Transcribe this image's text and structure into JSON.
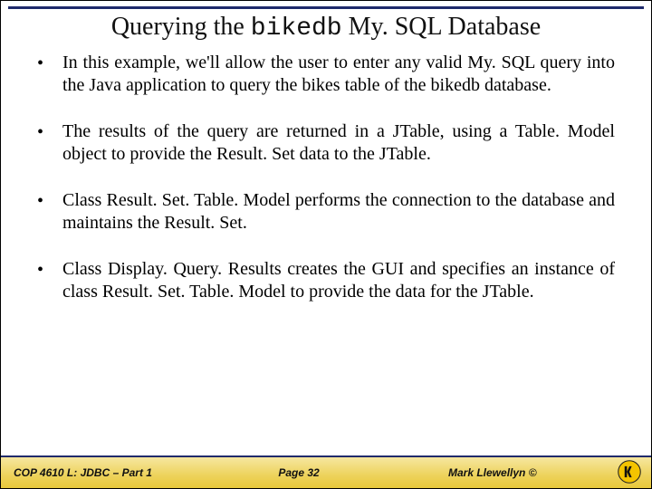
{
  "title": {
    "pre": "Querying the ",
    "code": "bikedb",
    "post": " My. SQL Database"
  },
  "bullets": [
    "In this example, we'll allow the user to enter any valid My. SQL query into the Java application to query the bikes table of the bikedb database.",
    "The results of the query are returned in a JTable, using a Table. Model object to provide the Result. Set data to the JTable.",
    "Class Result. Set. Table. Model performs the connection to the database and maintains the Result. Set.",
    "Class Display. Query. Results creates the GUI and specifies an instance of class Result. Set. Table. Model to provide the data for the JTable."
  ],
  "footer": {
    "left": "COP 4610 L: JDBC – Part 1",
    "center": "Page 32",
    "right": "Mark Llewellyn ©"
  }
}
